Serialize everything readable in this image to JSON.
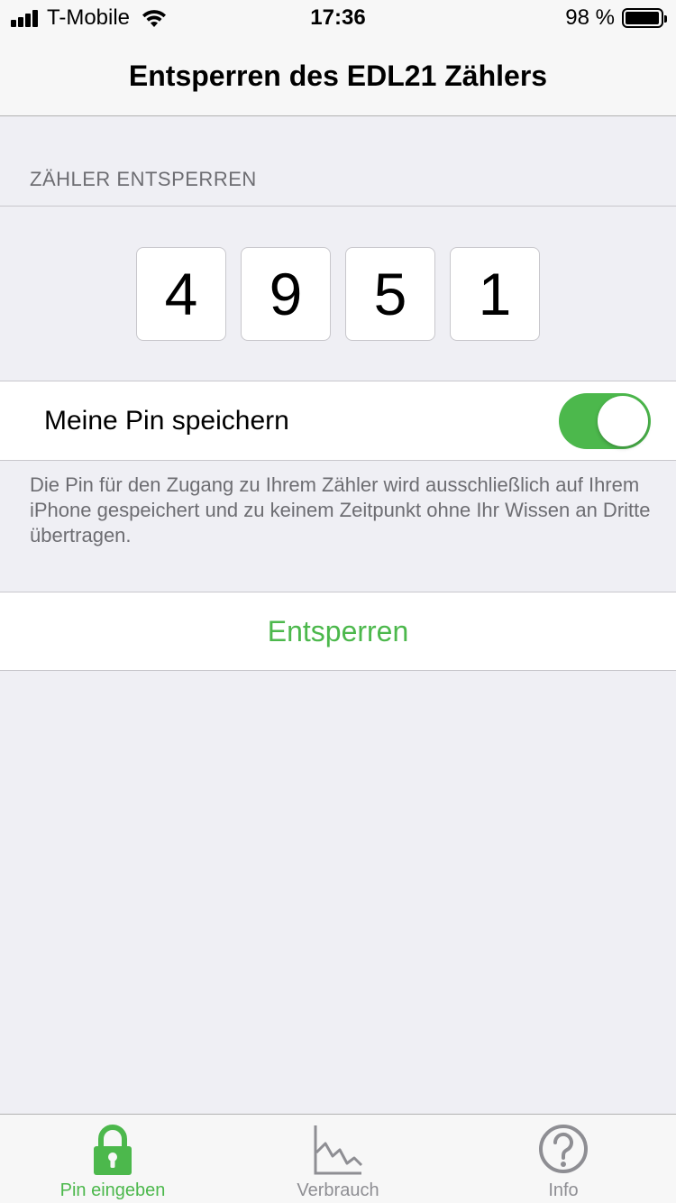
{
  "status_bar": {
    "carrier": "T-Mobile",
    "time": "17:36",
    "battery_percent": "98 %",
    "battery_level": 0.98
  },
  "nav": {
    "title": "Entsperren des EDL21 Zählers"
  },
  "unlock_section": {
    "header": "ZÄHLER ENTSPERREN",
    "pin_digits": [
      "4",
      "9",
      "5",
      "1"
    ]
  },
  "save_pin": {
    "label": "Meine Pin speichern",
    "enabled": true
  },
  "footnote": "Die Pin für den Zugang zu Ihrem Zähler wird ausschließlich auf Ihrem iPhone gespeichert und zu keinem Zeitpunkt ohne Ihr Wissen an Dritte übertragen.",
  "unlock_button": {
    "label": "Entsperren"
  },
  "tabbar": {
    "tabs": [
      {
        "label": "Pin eingeben",
        "icon": "lock-icon",
        "active": true
      },
      {
        "label": "Verbrauch",
        "icon": "chart-icon",
        "active": false
      },
      {
        "label": "Info",
        "icon": "question-circle-icon",
        "active": false
      }
    ]
  },
  "colors": {
    "accent": "#4cb84c",
    "background": "#efeff4",
    "inactive": "#8e8e93"
  }
}
